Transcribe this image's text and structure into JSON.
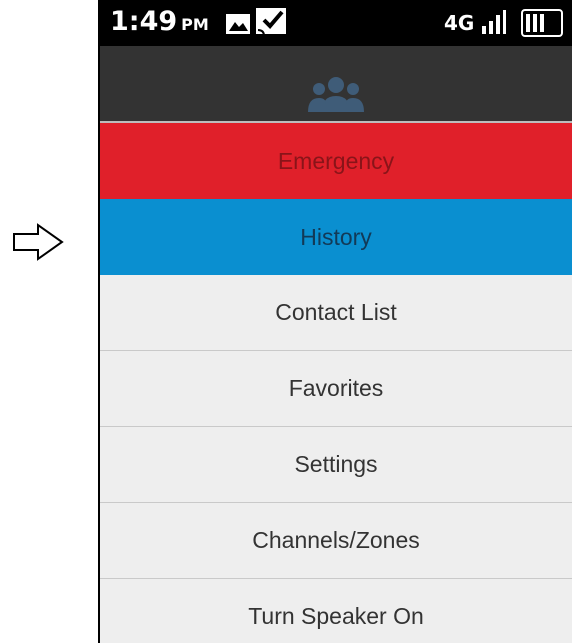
{
  "status_bar": {
    "time": "1:49",
    "ampm": "PM",
    "network_label": "4G"
  },
  "menu": {
    "items": [
      {
        "label": "Emergency"
      },
      {
        "label": "History"
      },
      {
        "label": "Contact List"
      },
      {
        "label": "Favorites"
      },
      {
        "label": "Settings"
      },
      {
        "label": "Channels/Zones"
      },
      {
        "label": "Turn Speaker On"
      }
    ]
  },
  "colors": {
    "emergency": "#e0202a",
    "history": "#0a8fd0",
    "header": "#333333",
    "menu_bg": "#eeeeee"
  },
  "icons": {
    "pointer": "right-arrow-icon",
    "header": "group-icon"
  }
}
